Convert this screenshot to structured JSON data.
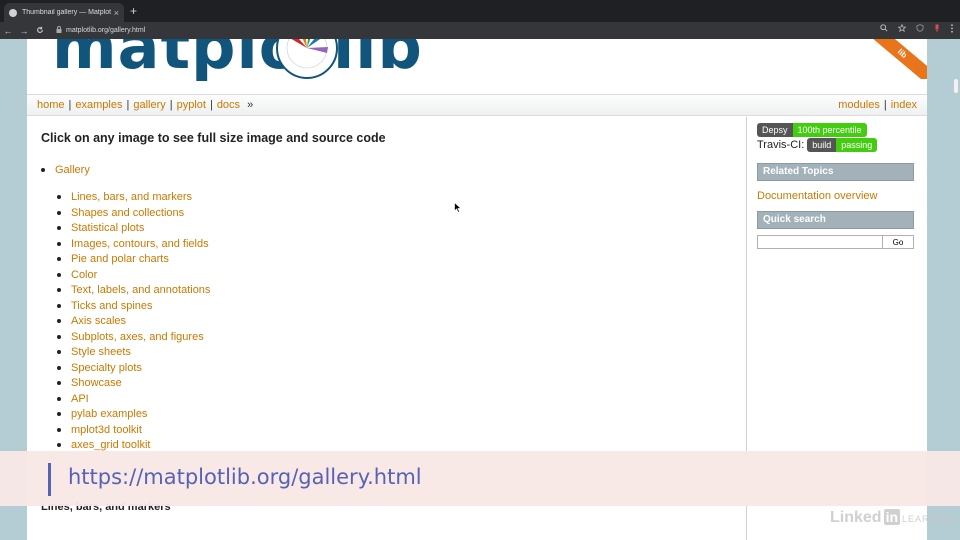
{
  "browser": {
    "tab_title": "Thumbnail gallery — Matplotlib",
    "tab_close": "×",
    "new_tab": "+",
    "url": "matplotlib.org/gallery.html",
    "back": "←",
    "forward": "→",
    "reload": "C",
    "lock": "🔒",
    "icons": [
      "zoom-icon",
      "star-icon",
      "shield-icon",
      "extension-icon",
      "menu-icon"
    ]
  },
  "header": {
    "logo_text": "matplotlib",
    "ribbon_text": "lib"
  },
  "navbar": {
    "left": [
      "home",
      "examples",
      "gallery",
      "pyplot",
      "docs"
    ],
    "more": "»",
    "right": [
      "modules",
      "index"
    ],
    "sep": "|"
  },
  "content": {
    "heading": "Click on any image to see full size image and source code",
    "gallery_link": "Gallery",
    "sections": [
      "Lines, bars, and markers",
      "Shapes and collections",
      "Statistical plots",
      "Images, contours, and fields",
      "Pie and polar charts",
      "Color",
      "Text, labels, and annotations",
      "Ticks and spines",
      "Axis scales",
      "Subplots, axes, and figures",
      "Style sheets",
      "Specialty plots",
      "Showcase",
      "API",
      "pylab examples",
      "mplot3d toolkit",
      "axes_grid toolkit"
    ],
    "below_banner_heading": "Lines, bars, and markers"
  },
  "sidebar": {
    "depsy_label": "Depsy",
    "depsy_value": "100th percentile",
    "travis_label": "Travis-CI:",
    "build_label": "build",
    "build_value": "passing",
    "related_topics": "Related Topics",
    "doc_overview": "Documentation overview",
    "quick_search": "Quick search",
    "search_value": "",
    "go_label": "Go"
  },
  "banner": {
    "url": "https://matplotlib.org/gallery.html"
  },
  "watermark": {
    "linked": "Linked",
    "in": "in",
    "learning": "LEARNING"
  },
  "colors": {
    "link": "#ca7900",
    "logo": "#11557c",
    "banner_text": "#5762b5",
    "badge_green": "#44cc11"
  }
}
